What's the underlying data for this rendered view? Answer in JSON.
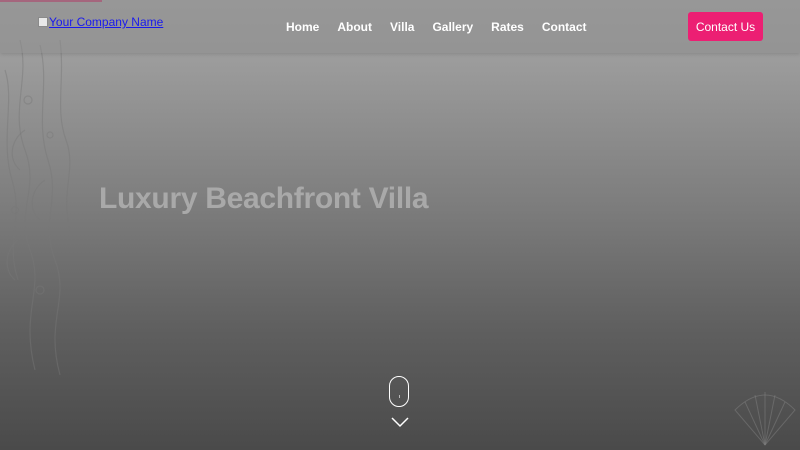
{
  "header": {
    "logo_alt": "Your Company Name",
    "nav": [
      {
        "label": "Home"
      },
      {
        "label": "About"
      },
      {
        "label": "Villa"
      },
      {
        "label": "Gallery"
      },
      {
        "label": "Rates"
      },
      {
        "label": "Contact"
      }
    ],
    "cta_label": "Contact Us"
  },
  "hero": {
    "title": "Luxury Beachfront Villa"
  },
  "icons": {
    "scroll": "mouse-scroll-icon",
    "arrow": "chevron-down-icon",
    "decor_left": "seaweed-decoration",
    "decor_right": "seashell-decoration"
  },
  "colors": {
    "accent": "#ec1f73",
    "nav_text": "#ffffff",
    "hero_title": "#a9a9a9"
  }
}
